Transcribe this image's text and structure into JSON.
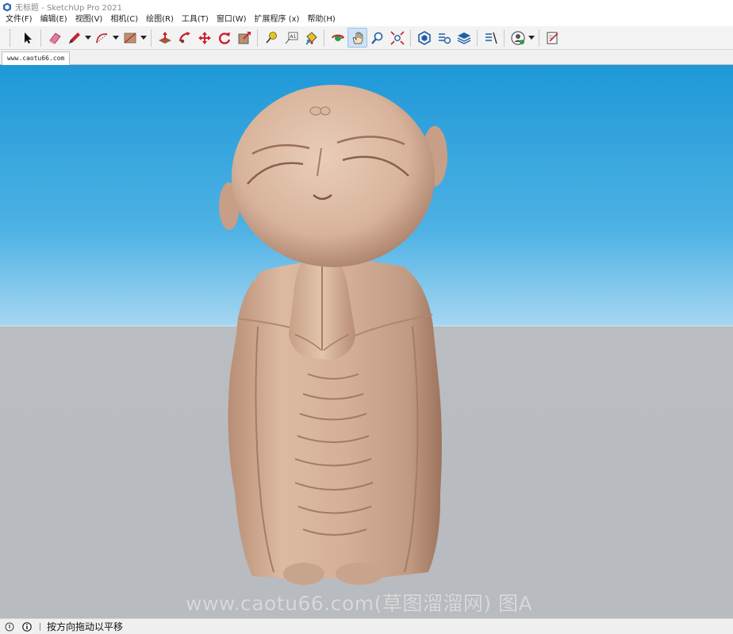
{
  "window": {
    "title": "无标题 - SketchUp Pro 2021"
  },
  "menu": [
    {
      "id": "file",
      "label": "文件(F)"
    },
    {
      "id": "edit",
      "label": "编辑(E)"
    },
    {
      "id": "view",
      "label": "视图(V)"
    },
    {
      "id": "camera",
      "label": "相机(C)"
    },
    {
      "id": "draw",
      "label": "绘图(R)"
    },
    {
      "id": "tools",
      "label": "工具(T)"
    },
    {
      "id": "window",
      "label": "窗口(W)"
    },
    {
      "id": "extensions",
      "label": "扩展程序 (x)"
    },
    {
      "id": "help",
      "label": "帮助(H)"
    }
  ],
  "toolbar": {
    "active_tool": "pan",
    "icons": [
      "select-icon",
      "eraser-icon",
      "pencil-icon",
      "arc-icon",
      "rectangle-icon",
      "push-pull-icon",
      "follow-me-icon",
      "move-icon",
      "rotate-icon",
      "scale-icon",
      "tape-measure-icon",
      "text-icon",
      "paint-bucket-icon",
      "orbit-icon",
      "pan-icon",
      "zoom-icon",
      "zoom-extents-icon",
      "warehouse-icon",
      "extension-warehouse-icon",
      "layout-icon",
      "style-builder-icon",
      "profile-icon",
      "send-to-layout-icon"
    ]
  },
  "tabs": {
    "scene_tab": "www.caotu66.com"
  },
  "viewport": {
    "watermark": "www.caotu66.com(草图溜溜网) 图A",
    "sky_color": "#1f98d8",
    "ground_color": "#b8bbbf"
  },
  "status": {
    "message": "按方向拖动以平移"
  }
}
